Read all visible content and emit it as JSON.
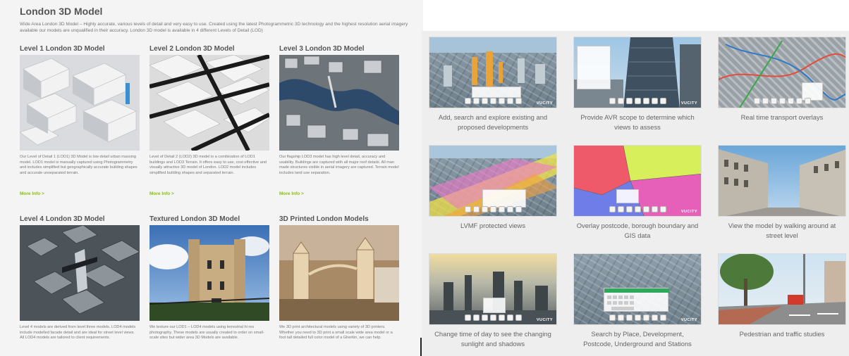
{
  "left": {
    "title": "London 3D Model",
    "intro": "Wide Area London 3D Model – Highly accurate, various levels of detail and very easy to use. Created using the latest Photogrammetric 3D technology and the highest resolution aerial imagery available our models are unqualified in their accuracy. London 3D model is available in 4 different Levels of Detail (LOD)",
    "cards": [
      {
        "title": "Level 1 London 3D Model",
        "desc": "Our Level of Detail 1 (LOD1) 3D Model is low detail urban massing model. LOD1 model is manually captured using Photogrammetry and includes simplified but geographically accurate building shapes and accurate unseparated terrain.",
        "more": "More Info >"
      },
      {
        "title": "Level 2 London 3D Model",
        "desc": "Level of Detail 2 (LOD2) 3D model is a combination of LOD1 buildings and LOD3 Terrain. It offers easy to use, cost effective and visually attractive 3D model of London. LOD2 model includes simplified building shapes and separated terrain.",
        "more": "More Info >"
      },
      {
        "title": "Level 3 London 3D Model",
        "desc": "Our flagship LOD3 model has high level detail, accuracy and usability. Buildings are captured with all major roof details. All man made structures visible in aerial imagery are captured. Terrain model includes land use separation.",
        "more": "More Info >"
      },
      {
        "title": "Level 4 London 3D Model",
        "desc": "Level 4 models are derived from level three models. LOD4 models include modelled facade detail and are ideal for street level views. All LOD4 models are tailored to client requirements.",
        "more": ""
      },
      {
        "title": "Textured London 3D Model",
        "desc": "We texture our LOD1 – LOD4 models using terrestrial hi res photography. These models are usually created to order on small-scale sites but wider area 3D Models are available.",
        "more": ""
      },
      {
        "title": "3D Printed London Models",
        "desc": "We 3D print architectural models using variety of 3D printers. Whether you need to 3D print a small scale wide area model or a foot tall detailed full color model of a Gherkin, we can help.",
        "more": ""
      }
    ]
  },
  "right": {
    "brand": "VUCITY",
    "tiles": [
      {
        "caption": "Add, search and explore existing and proposed developments"
      },
      {
        "caption": "Provide AVR scope to determine which views to assess"
      },
      {
        "caption": "Real time transport overlays"
      },
      {
        "caption": "LVMF protected views"
      },
      {
        "caption": "Overlay postcode, borough boundary and GIS data"
      },
      {
        "caption": "View the model by walking around at street level"
      },
      {
        "caption": "Change time of day to see the changing sunlight and shadows"
      },
      {
        "caption": "Search by Place, Development, Postcode, Underground and Stations"
      },
      {
        "caption": "Pedestrian and traffic studies"
      }
    ]
  }
}
